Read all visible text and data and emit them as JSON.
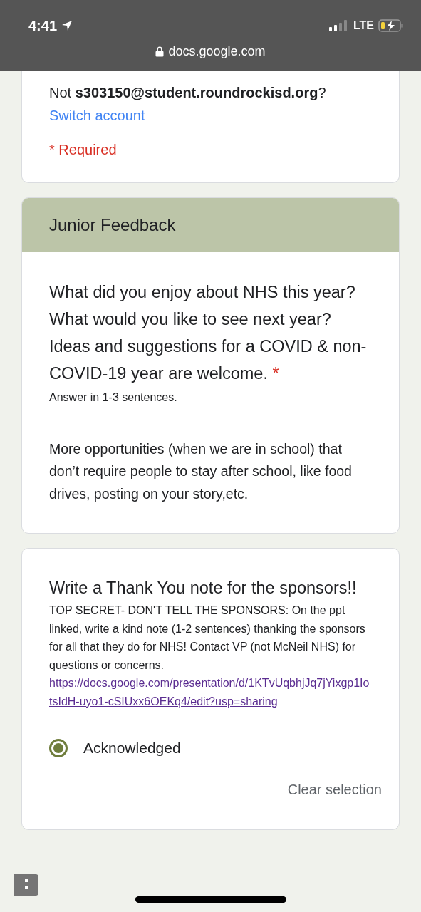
{
  "status_bar": {
    "time": "4:41",
    "network": "LTE",
    "url": "docs.google.com"
  },
  "account_card": {
    "account_line": "Not **s303150@student.roundrockisd.org**?",
    "switch_link": "Switch account",
    "required_note": "* Required"
  },
  "section": {
    "title": "Junior Feedback"
  },
  "question_1": {
    "text": "What did you enjoy about NHS this year? What would you like to see next year? Ideas and suggestions for a COVID & non-COVID-19 year are welcome.",
    "required_mark": "*",
    "description": "Answer in 1-3 sentences.",
    "answer": "More opportunities (when we are in school) that don’t require people to stay after school, like food drives, posting on your story,etc."
  },
  "question_2": {
    "text": "Write a Thank You note for the sponsors!!",
    "description": "TOP SECRET- DON'T TELL THE SPONSORS: On the ppt linked, write a kind note (1-2 sentences) thanking the sponsors for all that they do for NHS! Contact VP (not McNeil NHS) for questions or concerns.",
    "link": "https://docs.google.com/presentation/d/1KTvUqbhjJq7jYixgp1IotsIdH-uyo1-cSIUxx6OEKq4/edit?usp=sharing",
    "options": [
      {
        "label": "Acknowledged",
        "selected": true
      }
    ],
    "clear_selection": "Clear selection"
  }
}
